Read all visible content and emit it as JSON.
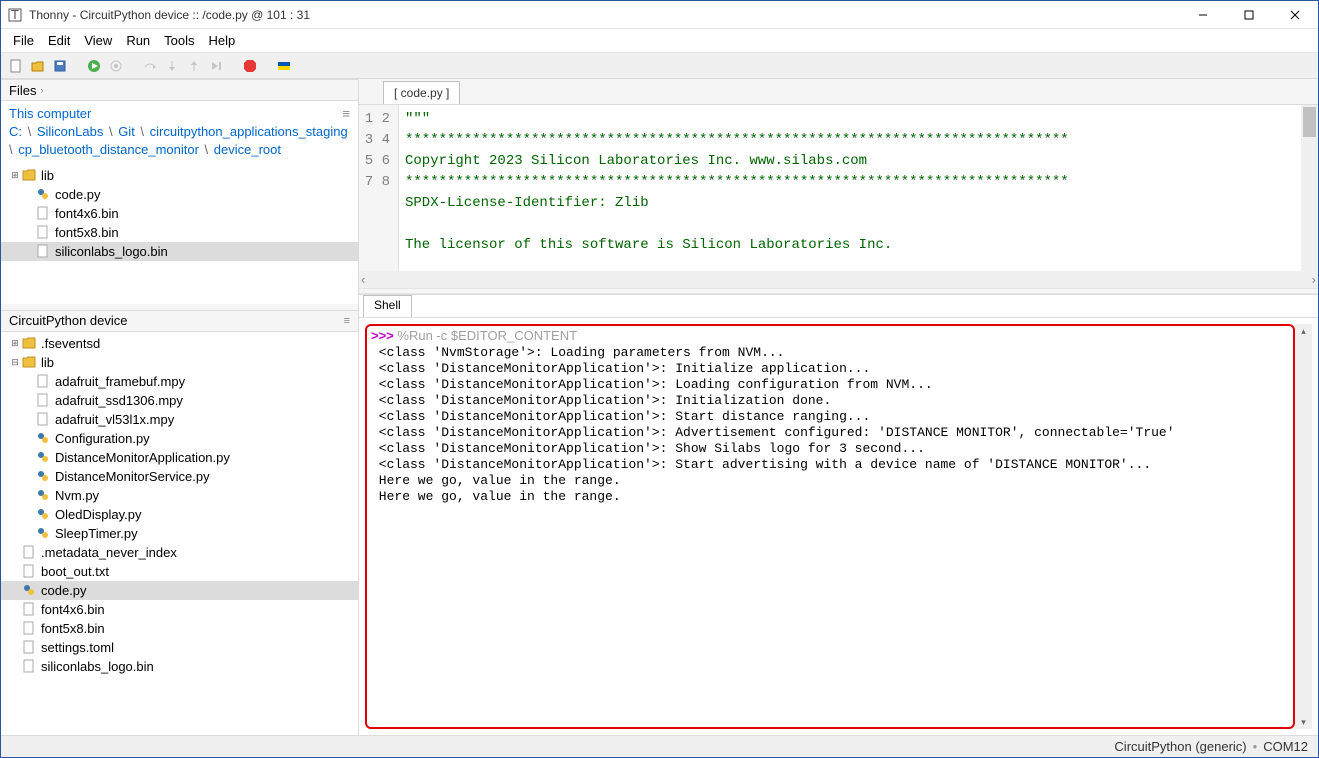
{
  "window": {
    "title": "Thonny  -  CircuitPython device :: /code.py  @  101 : 31"
  },
  "menu": {
    "file": "File",
    "edit": "Edit",
    "view": "View",
    "run": "Run",
    "tools": "Tools",
    "help": "Help"
  },
  "toolbar_icons": {
    "new": "new-file",
    "open": "open-file",
    "save": "save-file",
    "run": "run-script",
    "debug": "debug-script",
    "undo": "undo",
    "redo": "redo",
    "step_over": "step-over",
    "step_into": "step-into",
    "step_out": "step-out",
    "stop": "stop",
    "ukraine": "support-ukraine"
  },
  "files_panel": {
    "title": "Files",
    "breadcrumb_prefix": "This computer",
    "breadcrumb_parts": [
      "C:",
      "SiliconLabs",
      "Git",
      "circuitpython_applications_staging",
      "cp_bluetooth_distance_monitor",
      "device_root"
    ],
    "items": [
      {
        "type": "folder",
        "name": "lib",
        "expander": "+",
        "depth": 0
      },
      {
        "type": "py",
        "name": "code.py",
        "depth": 1
      },
      {
        "type": "file",
        "name": "font4x6.bin",
        "depth": 1
      },
      {
        "type": "file",
        "name": "font5x8.bin",
        "depth": 1
      },
      {
        "type": "file",
        "name": "siliconlabs_logo.bin",
        "depth": 1,
        "selected": true
      }
    ]
  },
  "device_panel": {
    "title": "CircuitPython device",
    "items": [
      {
        "type": "folder",
        "name": ".fseventsd",
        "expander": "+",
        "depth": 0
      },
      {
        "type": "folder",
        "name": "lib",
        "expander": "-",
        "depth": 0
      },
      {
        "type": "file",
        "name": "adafruit_framebuf.mpy",
        "depth": 1
      },
      {
        "type": "file",
        "name": "adafruit_ssd1306.mpy",
        "depth": 1
      },
      {
        "type": "file",
        "name": "adafruit_vl53l1x.mpy",
        "depth": 1
      },
      {
        "type": "py",
        "name": "Configuration.py",
        "depth": 1
      },
      {
        "type": "py",
        "name": "DistanceMonitorApplication.py",
        "depth": 1
      },
      {
        "type": "py",
        "name": "DistanceMonitorService.py",
        "depth": 1
      },
      {
        "type": "py",
        "name": "Nvm.py",
        "depth": 1
      },
      {
        "type": "py",
        "name": "OledDisplay.py",
        "depth": 1
      },
      {
        "type": "py",
        "name": "SleepTimer.py",
        "depth": 1
      },
      {
        "type": "file",
        "name": ".metadata_never_index",
        "depth": 0
      },
      {
        "type": "file",
        "name": "boot_out.txt",
        "depth": 0
      },
      {
        "type": "py",
        "name": "code.py",
        "depth": 0,
        "selected": true
      },
      {
        "type": "file",
        "name": "font4x6.bin",
        "depth": 0
      },
      {
        "type": "file",
        "name": "font5x8.bin",
        "depth": 0
      },
      {
        "type": "file",
        "name": "settings.toml",
        "depth": 0
      },
      {
        "type": "file",
        "name": "siliconlabs_logo.bin",
        "depth": 0
      }
    ]
  },
  "editor": {
    "tab_label": "[ code.py ]",
    "line_numbers": [
      "1",
      "2",
      "3",
      "4",
      "5",
      "6",
      "7",
      "8"
    ],
    "lines": [
      "\"\"\"",
      "*******************************************************************************",
      "Copyright 2023 Silicon Laboratories Inc. www.silabs.com",
      "*******************************************************************************",
      "SPDX-License-Identifier: Zlib",
      "",
      "The licensor of this software is Silicon Laboratories Inc.",
      ""
    ]
  },
  "shell": {
    "tab_label": "Shell",
    "prompt": ">>> ",
    "run_cmd": "%Run -c $EDITOR_CONTENT",
    "output_lines": [
      "<class 'NvmStorage'>: Loading parameters from NVM...",
      "<class 'DistanceMonitorApplication'>: Initialize application...",
      "<class 'DistanceMonitorApplication'>: Loading configuration from NVM...",
      "<class 'DistanceMonitorApplication'>: Initialization done.",
      "<class 'DistanceMonitorApplication'>: Start distance ranging...",
      "<class 'DistanceMonitorApplication'>: Advertisement configured: 'DISTANCE MONITOR', connectable='True'",
      "<class 'DistanceMonitorApplication'>: Show Silabs logo for 3 second...",
      "<class 'DistanceMonitorApplication'>: Start advertising with a device name of 'DISTANCE MONITOR'...",
      "Here we go, value in the range.",
      "Here we go, value in the range."
    ]
  },
  "statusbar": {
    "interpreter": "CircuitPython (generic)",
    "port": "COM12"
  }
}
